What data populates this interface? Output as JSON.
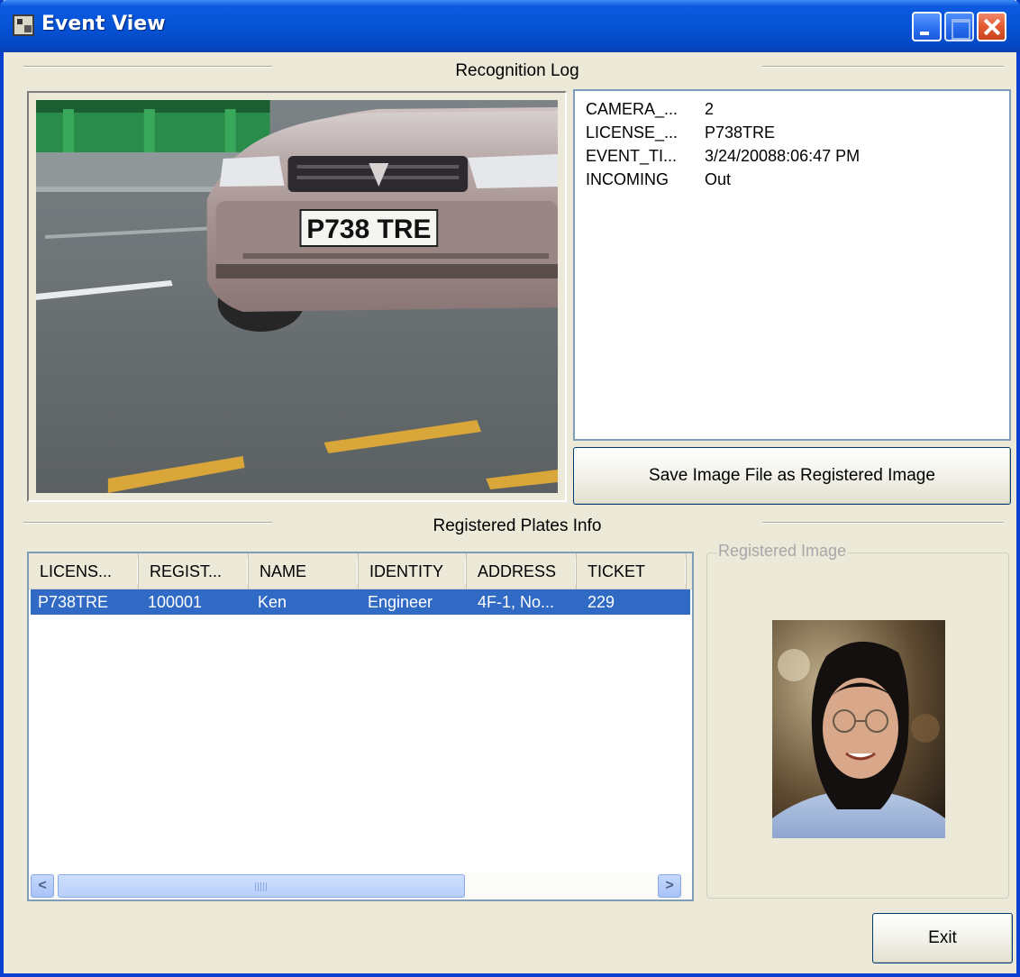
{
  "window": {
    "title": "Event View"
  },
  "recognition_log": {
    "heading": "Recognition Log",
    "rows": [
      {
        "key": "CAMERA_...",
        "value": "2"
      },
      {
        "key": "LICENSE_...",
        "value": "P738TRE"
      },
      {
        "key": "EVENT_TI...",
        "value": "3/24/20088:06:47 PM"
      },
      {
        "key": "INCOMING",
        "value": "Out"
      }
    ],
    "plate_text": "P738 TRE",
    "save_button": "Save Image File as Registered Image"
  },
  "registered": {
    "heading": "Registered Plates Info",
    "columns": [
      "LICENS...",
      "REGIST...",
      "NAME",
      "IDENTITY",
      "ADDRESS",
      "TICKET"
    ],
    "rows": [
      [
        "P738TRE",
        "100001",
        "Ken",
        "Engineer",
        "4F-1, No...",
        "229"
      ]
    ],
    "image_group_label": "Registered Image"
  },
  "footer": {
    "exit_button": "Exit"
  },
  "icons": [
    "app-icon",
    "minimize-icon",
    "maximize-icon",
    "close-icon",
    "scroll-left-icon",
    "scroll-right-icon"
  ],
  "colors": {
    "titlebar": "#0653d6",
    "selection": "#316ac5",
    "face": "#ece9d8"
  }
}
